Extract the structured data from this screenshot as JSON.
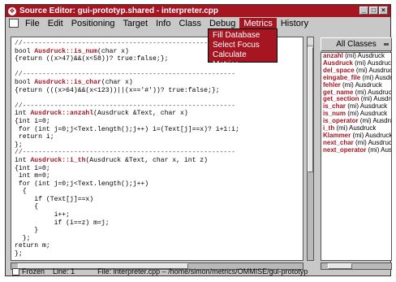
{
  "window": {
    "title": "Source Editor: gui-prototyp.shared - interpreter.cpp",
    "app_icon": "❖",
    "min_btn": "_",
    "max_btn": "□",
    "close_btn": "×"
  },
  "menubar": {
    "items": [
      "File",
      "Edit",
      "Positioning",
      "Target",
      "Info",
      "Class",
      "Debug",
      "Metrics",
      "History"
    ],
    "active": "Metrics"
  },
  "metrics_menu": {
    "items": [
      "Fill Database",
      "Select Focus",
      "Calculate Metrics"
    ]
  },
  "code_lines": [
    {
      "t": "//------------------------------------------------------",
      "sep": true
    },
    {
      "pre": "bool ",
      "fn": "Ausdruck::is_num",
      "post": "(char x)"
    },
    {
      "pre": "{return ((x>47)&&(x<58))? true:false;};"
    },
    {
      "pre": ""
    },
    {
      "t": "//------------------------------------------------------",
      "sep": true
    },
    {
      "pre": "bool ",
      "fn": "Ausdruck::is_char",
      "post": "(char x)"
    },
    {
      "pre": "{return (((x>64)&&(x<123))||(x=='#'))? true:false;};"
    },
    {
      "pre": ""
    },
    {
      "t": "//------------------------------------------------------",
      "sep": true
    },
    {
      "pre": "int ",
      "fn": "Ausdruck::anzahl",
      "post": "(Ausdruck &Text, char x)"
    },
    {
      "pre": "{int i=0;"
    },
    {
      "pre": " for (int j=0;j<Text.length();j++) i=(Text[j]==x)? i+1:i;"
    },
    {
      "pre": " return i;"
    },
    {
      "pre": "};"
    },
    {
      "t": "//------------------------------------------------------",
      "sep": true
    },
    {
      "pre": "int ",
      "fn": "Ausdruck::i_th",
      "post": "(Ausdruck &Text, char x, int z)"
    },
    {
      "pre": "{int i=0;"
    },
    {
      "pre": " int m=0;"
    },
    {
      "pre": " for (int j=0;j<Text.length();j++)"
    },
    {
      "pre": "  {"
    },
    {
      "pre": "     if (Text[j]==x)"
    },
    {
      "pre": "     {"
    },
    {
      "pre": "          i++;"
    },
    {
      "pre": "          if (i==z) m=j;"
    },
    {
      "pre": "     }"
    },
    {
      "pre": "  };"
    },
    {
      "pre": "return m;"
    },
    {
      "pre": "};"
    }
  ],
  "class_panel": {
    "selector_label": "All Classes",
    "rows": [
      {
        "name": "anzahl",
        "rest": " (mi) Ausdruck"
      },
      {
        "name": "Ausdruck",
        "rest": " (mi) Ausdruck"
      },
      {
        "name": "del_space",
        "rest": " (mi) Ausdruck"
      },
      {
        "name": "eingabe_file",
        "rest": " (mi) Ausdr"
      },
      {
        "name": "fehler",
        "rest": " (mi) Ausdruck"
      },
      {
        "name": "get_name",
        "rest": " (mi) Ausdruck"
      },
      {
        "name": "get_section",
        "rest": " (mi) Ausdru"
      },
      {
        "name": "is_char",
        "rest": " (mi) Ausdruck"
      },
      {
        "name": "is_num",
        "rest": " (mi) Ausdruck"
      },
      {
        "name": "is_operator",
        "rest": " (mi) Ausdru"
      },
      {
        "name": "i_th",
        "rest": " (mi) Ausdruck"
      },
      {
        "name": "Klammer",
        "rest": " (mi) Ausdruck"
      },
      {
        "name": "next_char",
        "rest": " (mi) Ausdruck"
      },
      {
        "name": "next_operator",
        "rest": " (mi) Ausc"
      }
    ]
  },
  "status": {
    "frozen_label": "Frozen",
    "line_label": "Line:",
    "line_value": "1",
    "file_label": "File:",
    "file_value": "interpreter.cpp – /home/simon/metrics/OMMISE/gui-prototyp"
  },
  "colors": {
    "accent": "#a51522",
    "chrome": "#c8c8c8"
  }
}
